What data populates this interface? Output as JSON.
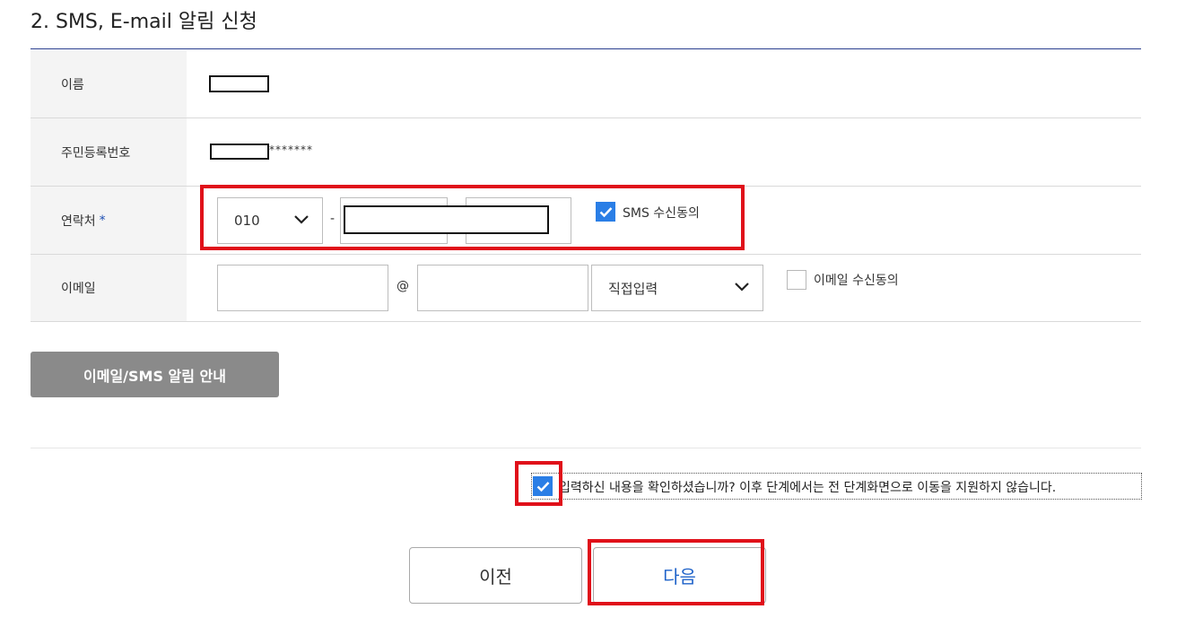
{
  "section": {
    "title": "2. SMS, E-mail 알림 신청"
  },
  "form": {
    "name": {
      "label": "이름"
    },
    "rrn": {
      "label": "주민등록번호",
      "masked_suffix": "*******"
    },
    "contact": {
      "label": "연락처",
      "required_mark": "*",
      "prefix_value": "010",
      "separator": "-",
      "sms_consent_label": "SMS 수신동의",
      "sms_consent_checked": true
    },
    "email": {
      "label": "이메일",
      "at_symbol": "@",
      "domain_select_value": "직접입력",
      "email_consent_label": "이메일 수신동의",
      "email_consent_checked": false
    }
  },
  "info_button": {
    "label": "이메일/SMS 알림 안내"
  },
  "confirm": {
    "text": "입력하신 내용을 확인하셨습니까? 이후 단계에서는 전 단계화면으로 이동을 지원하지 않습니다.",
    "checked": true
  },
  "nav": {
    "prev_label": "이전",
    "next_label": "다음"
  },
  "colors": {
    "accent": "#2a7ee6",
    "highlight": "#e0101a",
    "next_text": "#1e62c9",
    "info_button_bg": "#8a8a8a"
  }
}
